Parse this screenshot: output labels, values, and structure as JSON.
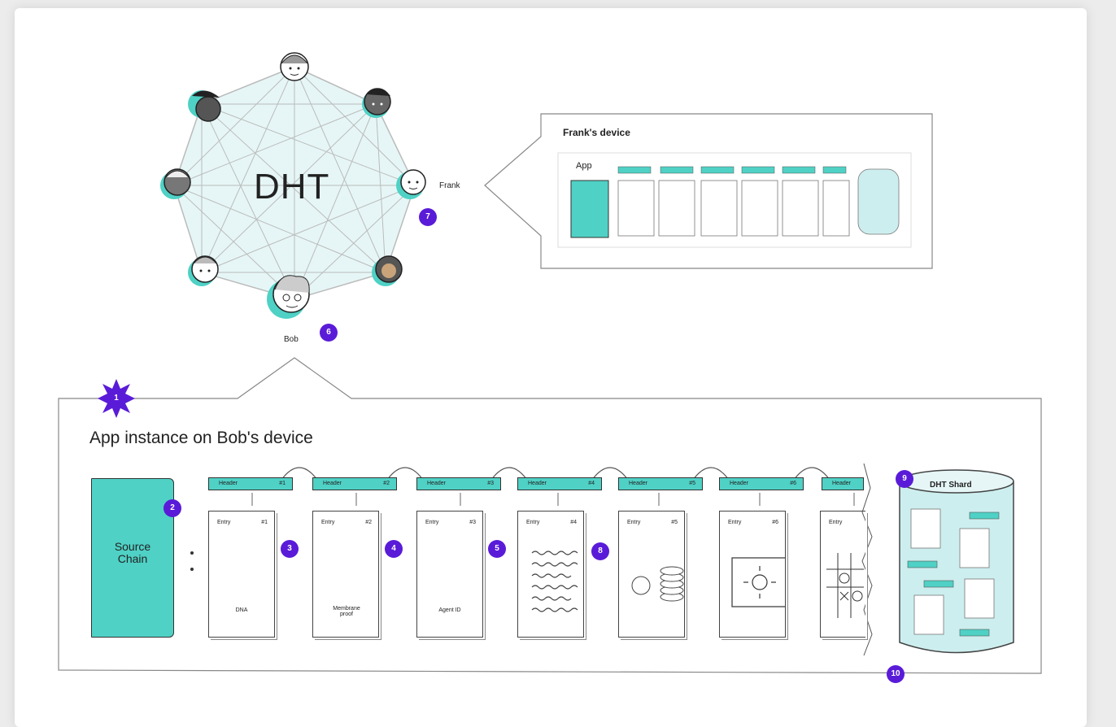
{
  "dht": {
    "label": "DHT"
  },
  "peers": {
    "frank": "Frank",
    "bob": "Bob"
  },
  "frank_device": {
    "title": "Frank's device",
    "app_label": "App"
  },
  "bob_device": {
    "title": "App instance on Bob's device"
  },
  "source_chain": {
    "label_line1": "Source",
    "label_line2": "Chain"
  },
  "headers": [
    {
      "label": "Header",
      "num": "#1"
    },
    {
      "label": "Header",
      "num": "#2"
    },
    {
      "label": "Header",
      "num": "#3"
    },
    {
      "label": "Header",
      "num": "#4"
    },
    {
      "label": "Header",
      "num": "#5"
    },
    {
      "label": "Header",
      "num": "#6"
    },
    {
      "label": "Header",
      "num": ""
    }
  ],
  "entries": [
    {
      "label": "Entry",
      "num": "#1",
      "caption": "DNA"
    },
    {
      "label": "Entry",
      "num": "#2",
      "caption": "Membrane proof"
    },
    {
      "label": "Entry",
      "num": "#3",
      "caption": "Agent ID"
    },
    {
      "label": "Entry",
      "num": "#4",
      "caption": ""
    },
    {
      "label": "Entry",
      "num": "#5",
      "caption": ""
    },
    {
      "label": "Entry",
      "num": "#6",
      "caption": ""
    },
    {
      "label": "Entry",
      "num": "",
      "caption": ""
    }
  ],
  "dht_shard": {
    "title": "DHT Shard"
  },
  "badges": [
    "1",
    "2",
    "3",
    "4",
    "5",
    "6",
    "7",
    "8",
    "9",
    "10"
  ],
  "colors": {
    "teal": "#4fd1c5",
    "purple": "#5a1bd8",
    "network_fill": "#e6f6f6"
  },
  "icons": [
    "dna-icon",
    "ticket-icon",
    "key-icon",
    "scribble-icon",
    "coin-stack-icon",
    "sun-frame-icon",
    "tic-tac-toe-icon"
  ]
}
